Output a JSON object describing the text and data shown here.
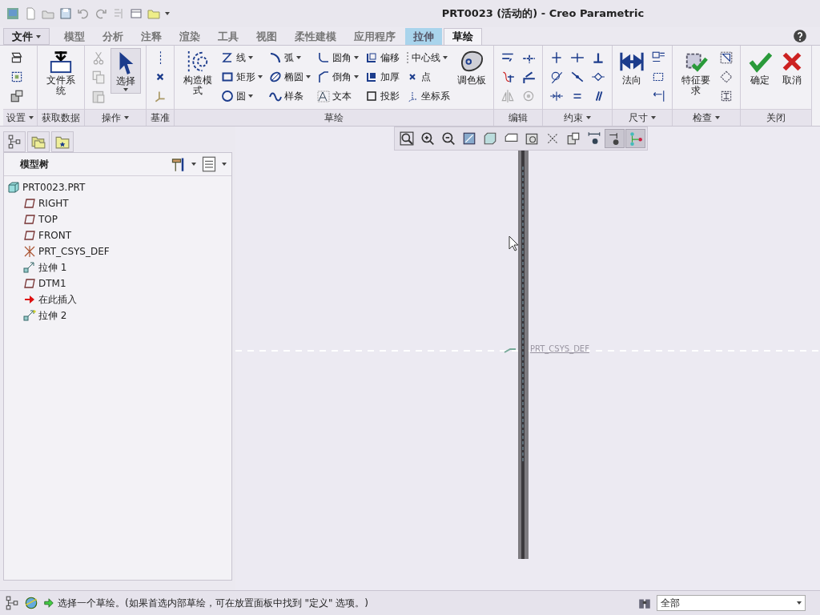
{
  "window": {
    "title": "PRT0023 (活动的) - Creo Parametric"
  },
  "tabs": [
    {
      "label": "文件",
      "kind": "menu",
      "selected": false
    },
    {
      "label": "模型",
      "kind": "tab",
      "selected": false
    },
    {
      "label": "分析",
      "kind": "tab",
      "selected": false
    },
    {
      "label": "注释",
      "kind": "tab",
      "selected": false
    },
    {
      "label": "渲染",
      "kind": "tab",
      "selected": false
    },
    {
      "label": "工具",
      "kind": "tab",
      "selected": false
    },
    {
      "label": "视图",
      "kind": "tab",
      "selected": false
    },
    {
      "label": "柔性建模",
      "kind": "tab",
      "selected": false
    },
    {
      "label": "应用程序",
      "kind": "tab",
      "selected": false
    },
    {
      "label": "拉伸",
      "kind": "context",
      "selected": false
    },
    {
      "label": "草绘",
      "kind": "tab",
      "selected": true
    }
  ],
  "ribbon": {
    "groups": [
      {
        "label": "设置",
        "dropdown": true,
        "items": [
          {
            "kind": "icon"
          },
          {
            "kind": "icon"
          },
          {
            "kind": "icon"
          }
        ]
      },
      {
        "label": "获取数据",
        "dropdown": false,
        "items": [
          {
            "kind": "large",
            "label": "文件系统",
            "dropdown": false
          }
        ]
      },
      {
        "label": "操作",
        "dropdown": true,
        "items": [
          {
            "kind": "icon"
          },
          {
            "kind": "icon"
          },
          {
            "kind": "icon"
          },
          {
            "kind": "large",
            "label": "选择",
            "dropdown": true
          }
        ]
      },
      {
        "label": "基准",
        "dropdown": false,
        "items": [
          {
            "kind": "icon"
          },
          {
            "kind": "icon"
          },
          {
            "kind": "icon"
          }
        ]
      },
      {
        "label": "草绘",
        "dropdown": false,
        "items": [
          {
            "kind": "large",
            "label": "构造模式",
            "dropdown": false
          },
          {
            "kind": "small",
            "label": "线",
            "dropdown": true
          },
          {
            "kind": "small",
            "label": "矩形",
            "dropdown": true
          },
          {
            "kind": "small",
            "label": "圆",
            "dropdown": true
          },
          {
            "kind": "small",
            "label": "弧",
            "dropdown": true
          },
          {
            "kind": "small",
            "label": "椭圆",
            "dropdown": true
          },
          {
            "kind": "small",
            "label": "样条",
            "dropdown": false
          },
          {
            "kind": "small",
            "label": "圆角",
            "dropdown": true
          },
          {
            "kind": "small",
            "label": "倒角",
            "dropdown": true
          },
          {
            "kind": "small",
            "label": "文本",
            "dropdown": false
          },
          {
            "kind": "small",
            "label": "偏移",
            "dropdown": false
          },
          {
            "kind": "small",
            "label": "加厚",
            "dropdown": false
          },
          {
            "kind": "small",
            "label": "投影",
            "dropdown": false
          },
          {
            "kind": "small",
            "label": "中心线",
            "dropdown": true
          },
          {
            "kind": "small",
            "label": "点",
            "dropdown": false
          },
          {
            "kind": "small",
            "label": "坐标系",
            "dropdown": false
          },
          {
            "kind": "large",
            "label": "调色板",
            "dropdown": false
          }
        ]
      },
      {
        "label": "编辑",
        "dropdown": false,
        "items": [
          {
            "kind": "icon"
          },
          {
            "kind": "icon"
          },
          {
            "kind": "icon"
          },
          {
            "kind": "icon"
          },
          {
            "kind": "icon"
          },
          {
            "kind": "icon"
          }
        ]
      },
      {
        "label": "约束",
        "dropdown": true,
        "items": [
          {
            "kind": "icon"
          },
          {
            "kind": "icon"
          },
          {
            "kind": "icon"
          },
          {
            "kind": "icon"
          },
          {
            "kind": "icon"
          },
          {
            "kind": "icon"
          },
          {
            "kind": "icon"
          },
          {
            "kind": "icon"
          },
          {
            "kind": "icon"
          }
        ]
      },
      {
        "label": "尺寸",
        "dropdown": true,
        "items": [
          {
            "kind": "large",
            "label": "法向",
            "dropdown": false
          },
          {
            "kind": "icon"
          },
          {
            "kind": "icon"
          },
          {
            "kind": "icon"
          }
        ]
      },
      {
        "label": "检查",
        "dropdown": true,
        "items": [
          {
            "kind": "large",
            "label": "特征要求",
            "dropdown": false
          },
          {
            "kind": "icon"
          },
          {
            "kind": "icon"
          },
          {
            "kind": "icon"
          }
        ]
      },
      {
        "label": "关闭",
        "dropdown": false,
        "items": [
          {
            "kind": "large",
            "label": "确定",
            "dropdown": false
          },
          {
            "kind": "large",
            "label": "取消",
            "dropdown": false
          }
        ]
      }
    ]
  },
  "model_tree": {
    "title": "模型树",
    "items": [
      {
        "label": "PRT0023.PRT",
        "kind": "part",
        "children": [
          {
            "label": "RIGHT",
            "kind": "plane"
          },
          {
            "label": "TOP",
            "kind": "plane"
          },
          {
            "label": "FRONT",
            "kind": "plane"
          },
          {
            "label": "PRT_CSYS_DEF",
            "kind": "csys"
          },
          {
            "label": "拉伸 1",
            "kind": "extrude"
          },
          {
            "label": "DTM1",
            "kind": "plane"
          },
          {
            "label": "在此插入",
            "kind": "insert"
          },
          {
            "label": "拉伸 2",
            "kind": "new_extrude"
          }
        ]
      }
    ]
  },
  "view_toolbar": [
    {
      "on": false
    },
    {
      "on": false
    },
    {
      "on": false
    },
    {
      "on": false
    },
    {
      "on": false
    },
    {
      "on": false
    },
    {
      "on": false
    },
    {
      "on": false
    },
    {
      "on": false
    },
    {
      "on": false
    },
    {
      "on": true
    },
    {
      "on": true
    }
  ],
  "canvas": {
    "csys_label": "PRT_CSYS_DEF"
  },
  "status_bar": {
    "message": "选择一个草绘。(如果首选内部草绘，可在放置面板中找到 \"定义\" 选项。)",
    "filter": "全部"
  }
}
